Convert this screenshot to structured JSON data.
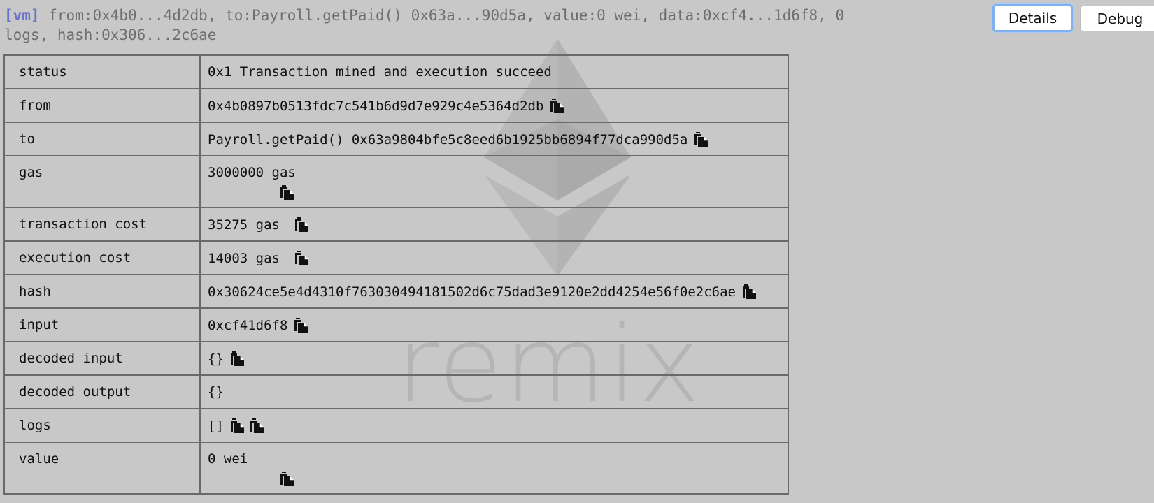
{
  "summary": {
    "tag": "[vm]",
    "text": "from:0x4b0...4d2db, to:Payroll.getPaid() 0x63a...90d5a, value:0 wei, data:0xcf4...1d6f8, 0 logs, hash:0x306...2c6ae"
  },
  "buttons": {
    "details": "Details",
    "debug": "Debug"
  },
  "watermark": {
    "text": "remix",
    "logo_icon": "ethereum-diamond-icon"
  },
  "rows": {
    "status": {
      "key": "status",
      "value": "0x1 Transaction mined and execution succeed"
    },
    "from": {
      "key": "from",
      "value": "0x4b0897b0513fdc7c541b6d9d7e929c4e5364d2db"
    },
    "to": {
      "key": "to",
      "value": "Payroll.getPaid() 0x63a9804bfe5c8eed6b1925bb6894f77dca990d5a"
    },
    "gas": {
      "key": "gas",
      "value": "3000000 gas"
    },
    "transaction_cost": {
      "key": "transaction cost",
      "value": "35275 gas"
    },
    "execution_cost": {
      "key": "execution cost",
      "value": "14003 gas"
    },
    "hash": {
      "key": "hash",
      "value": "0x30624ce5e4d4310f763030494181502d6c75dad3e9120e2dd4254e56f0e2c6ae"
    },
    "input": {
      "key": "input",
      "value": "0xcf41d6f8"
    },
    "decoded_input": {
      "key": "decoded input",
      "value": "{}"
    },
    "decoded_output": {
      "key": "decoded output",
      "value": "{}"
    },
    "logs": {
      "key": "logs",
      "value": "[]"
    },
    "value": {
      "key": "value",
      "value": "0 wei"
    }
  },
  "icons": {
    "copy": "copy-clipboard-icon"
  },
  "colors": {
    "background": "#c8c8c8",
    "summary_text": "#6e6e6e",
    "vm_tag": "#6a72c8",
    "details_focus": "#7fb1f0",
    "table_border": "#6a6a6a"
  }
}
